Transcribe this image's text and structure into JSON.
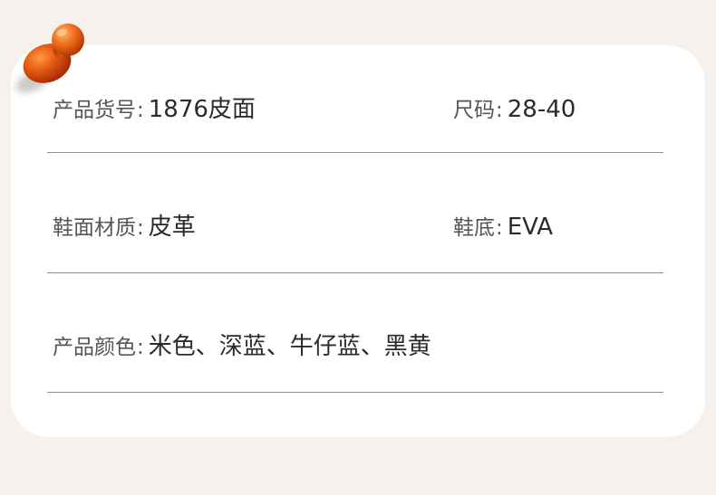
{
  "info": {
    "item_no": {
      "label": "产品货号",
      "value": "1876皮面"
    },
    "size": {
      "label": "尺码",
      "value": "28-40"
    },
    "upper_material": {
      "label": "鞋面材质",
      "value": "皮革"
    },
    "sole": {
      "label": "鞋底",
      "value": "EVA"
    },
    "colors": {
      "label": "产品颜色",
      "value": "米色、深蓝、牛仔蓝、黑黄"
    },
    "separator": ":"
  },
  "colors": {
    "background": "#f6f1ec",
    "card": "#ffffff",
    "pin": "#d3470f",
    "divider": "#8f8f8f"
  },
  "icons": {
    "pin": "push-pin-icon"
  }
}
